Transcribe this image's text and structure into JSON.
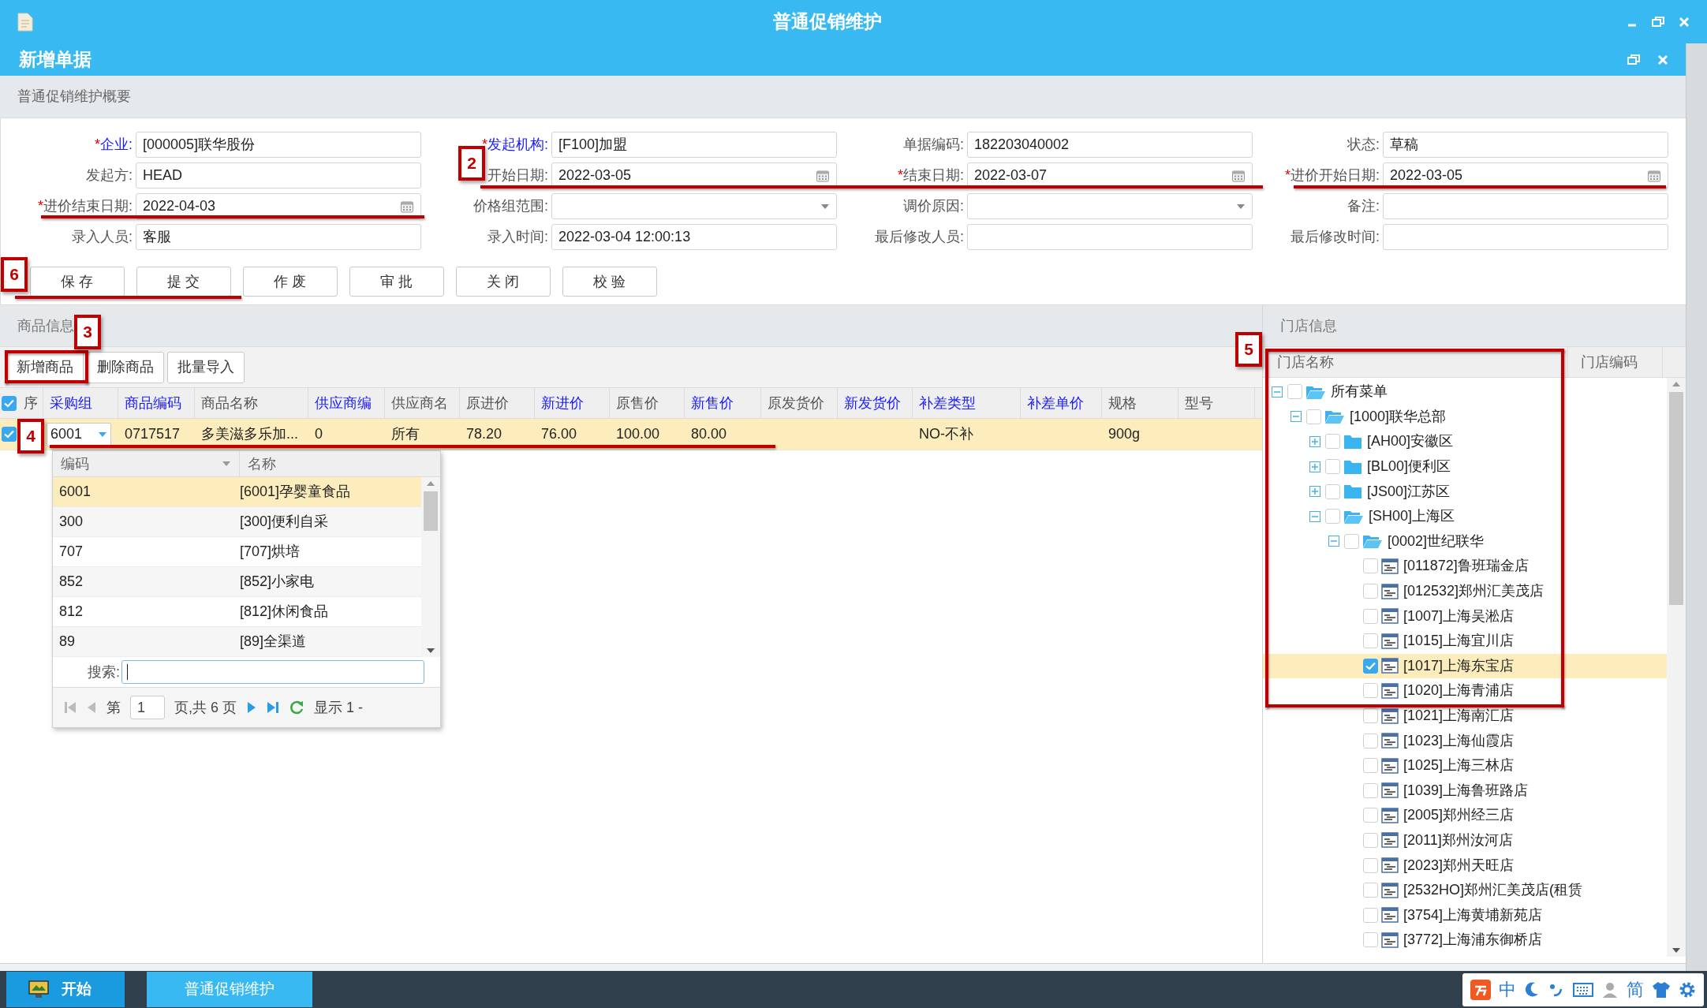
{
  "window": {
    "title": "普通促销维护"
  },
  "document": {
    "title": "新增单据"
  },
  "summary": {
    "title": "普通促销维护概要",
    "fields": [
      {
        "label": "企业:",
        "mark": "*",
        "link": true,
        "kind": "text",
        "value": "[000005]联华股份"
      },
      {
        "label": "发起机构:",
        "mark": "*",
        "link": true,
        "kind": "text",
        "value": "[F100]加盟"
      },
      {
        "label": "单据编码:",
        "kind": "text",
        "value": "182203040002"
      },
      {
        "label": "状态:",
        "kind": "text",
        "value": "草稿"
      },
      {
        "label": "发起方:",
        "kind": "text",
        "value": "HEAD"
      },
      {
        "label": "开始日期:",
        "kind": "date",
        "value": "2022-03-05"
      },
      {
        "label": "结束日期:",
        "mark": "*",
        "kind": "date",
        "value": "2022-03-07"
      },
      {
        "label": "进价开始日期:",
        "mark": "*",
        "kind": "date",
        "value": "2022-03-05"
      },
      {
        "label": "进价结束日期:",
        "mark": "*",
        "kind": "date",
        "value": "2022-04-03"
      },
      {
        "label": "价格组范围:",
        "kind": "select"
      },
      {
        "label": "调价原因:",
        "kind": "select"
      },
      {
        "label": "备注:",
        "kind": "text"
      },
      {
        "label": "录入人员:",
        "kind": "text",
        "value": "客服"
      },
      {
        "label": "录入时间:",
        "kind": "text",
        "value": "2022-03-04 12:00:13"
      },
      {
        "label": "最后修改人员:",
        "kind": "text"
      },
      {
        "label": "最后修改时间:",
        "kind": "text"
      }
    ],
    "buttons": [
      "保 存",
      "提 交",
      "作 废",
      "审 批",
      "关 闭",
      "校 验"
    ]
  },
  "goods": {
    "title": "商品信息",
    "toolbar": [
      "新增商品",
      "删除商品",
      "批量导入"
    ],
    "all_checked": true,
    "columns": [
      {
        "label": "序",
        "editable": false
      },
      {
        "label": "采购组",
        "editable": true
      },
      {
        "label": "商品编码",
        "editable": true
      },
      {
        "label": "商品名称",
        "editable": false
      },
      {
        "label": "供应商编",
        "editable": true
      },
      {
        "label": "供应商名",
        "editable": false
      },
      {
        "label": "原进价",
        "editable": false
      },
      {
        "label": "新进价",
        "editable": true
      },
      {
        "label": "原售价",
        "editable": false
      },
      {
        "label": "新售价",
        "editable": true
      },
      {
        "label": "原发货价",
        "editable": false
      },
      {
        "label": "新发货价",
        "editable": true
      },
      {
        "label": "补差类型",
        "editable": true
      },
      {
        "label": "补差单价",
        "editable": true
      },
      {
        "label": "规格",
        "editable": false
      },
      {
        "label": "型号",
        "editable": false
      }
    ],
    "rows": [
      {
        "selected": true,
        "cells": [
          null,
          "6001",
          "0717517",
          "多美滋多乐加...",
          "0",
          "所有",
          "78.20",
          "76.00",
          "100.00",
          "80.00",
          null,
          null,
          "NO-不补",
          null,
          "900g",
          null
        ]
      }
    ],
    "dropdown": {
      "columns": [
        "编码",
        "名称"
      ],
      "rows": [
        {
          "code": "6001",
          "name": "[6001]孕婴童食品",
          "selected": true
        },
        {
          "code": "300",
          "name": "[300]便利自采",
          "selected": false
        },
        {
          "code": "707",
          "name": "[707]烘培",
          "selected": false
        },
        {
          "code": "852",
          "name": "[852]小家电",
          "selected": false
        },
        {
          "code": "812",
          "name": "[812]休闲食品",
          "selected": false
        },
        {
          "code": "89",
          "name": "[89]全渠道",
          "selected": false
        }
      ],
      "search_label": "搜索:",
      "pager": {
        "before": "第",
        "page": "1",
        "after": "页,共 6 页",
        "display": "显示 1 -"
      }
    }
  },
  "stores": {
    "title": "门店信息",
    "columns": [
      "门店名称",
      "门店编码"
    ],
    "tree": [
      {
        "label": "所有菜单",
        "kind": "folder",
        "expanded": true,
        "checked": false,
        "selected": false,
        "children": [
          {
            "label": "[1000]联华总部",
            "kind": "folder",
            "expanded": true,
            "checked": false,
            "selected": false,
            "children": [
              {
                "label": "[AH00]安徽区",
                "kind": "folder",
                "expanded": false,
                "checked": false,
                "selected": false
              },
              {
                "label": "[BL00]便利区",
                "kind": "folder",
                "expanded": false,
                "checked": false,
                "selected": false
              },
              {
                "label": "[JS00]江苏区",
                "kind": "folder",
                "expanded": false,
                "checked": false,
                "selected": false
              },
              {
                "label": "[SH00]上海区",
                "kind": "folder",
                "expanded": true,
                "checked": false,
                "selected": false,
                "children": [
                  {
                    "label": "[0002]世纪联华",
                    "kind": "folder",
                    "expanded": true,
                    "checked": false,
                    "selected": false,
                    "children": [
                      {
                        "label": "[011872]鲁班瑞金店",
                        "kind": "store",
                        "checked": false,
                        "selected": false
                      },
                      {
                        "label": "[012532]郑州汇美茂店",
                        "kind": "store",
                        "checked": false,
                        "selected": false
                      },
                      {
                        "label": "[1007]上海吴淞店",
                        "kind": "store",
                        "checked": false,
                        "selected": false
                      },
                      {
                        "label": "[1015]上海宜川店",
                        "kind": "store",
                        "checked": false,
                        "selected": false
                      },
                      {
                        "label": "[1017]上海东宝店",
                        "kind": "store",
                        "checked": true,
                        "selected": true
                      },
                      {
                        "label": "[1020]上海青浦店",
                        "kind": "store",
                        "checked": false,
                        "selected": false
                      },
                      {
                        "label": "[1021]上海南汇店",
                        "kind": "store",
                        "checked": false,
                        "selected": false
                      },
                      {
                        "label": "[1023]上海仙霞店",
                        "kind": "store",
                        "checked": false,
                        "selected": false
                      },
                      {
                        "label": "[1025]上海三林店",
                        "kind": "store",
                        "checked": false,
                        "selected": false
                      },
                      {
                        "label": "[1039]上海鲁班路店",
                        "kind": "store",
                        "checked": false,
                        "selected": false
                      },
                      {
                        "label": "[2005]郑州经三店",
                        "kind": "store",
                        "checked": false,
                        "selected": false
                      },
                      {
                        "label": "[2011]郑州汝河店",
                        "kind": "store",
                        "checked": false,
                        "selected": false
                      },
                      {
                        "label": "[2023]郑州天旺店",
                        "kind": "store",
                        "checked": false,
                        "selected": false
                      },
                      {
                        "label": "[2532HO]郑州汇美茂店(租赁",
                        "kind": "store",
                        "checked": false,
                        "selected": false
                      },
                      {
                        "label": "[3754]上海黄埔新苑店",
                        "kind": "store",
                        "checked": false,
                        "selected": false
                      },
                      {
                        "label": "[3772]上海浦东御桥店",
                        "kind": "store",
                        "checked": false,
                        "selected": false
                      }
                    ]
                  }
                ]
              }
            ]
          }
        ]
      }
    ]
  },
  "annotations": [
    {
      "label": "2"
    },
    {
      "label": "6"
    },
    {
      "label": "3"
    },
    {
      "label": "5"
    },
    {
      "label": "4"
    }
  ],
  "taskbar": {
    "start": "开始",
    "tasks": [
      {
        "label": "普通促销维护",
        "selected": true
      }
    ],
    "tray_text": [
      "中",
      "简"
    ]
  }
}
